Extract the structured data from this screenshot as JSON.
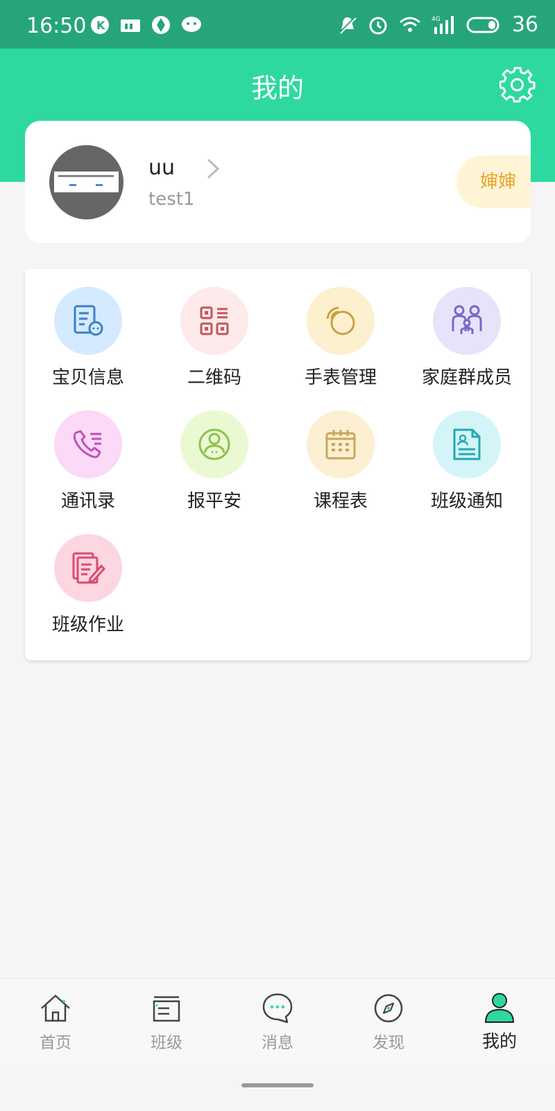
{
  "status_bar": {
    "time": "16:50",
    "left_icons": [
      "k-app-icon",
      "sim-card-icon",
      "aperture-icon",
      "wechat-icon"
    ],
    "right_icons": [
      "bell-muted-icon",
      "alarm-clock-icon",
      "wifi-icon",
      "signal-4g-icon",
      "battery-icon"
    ],
    "battery_level": "36"
  },
  "header": {
    "title": "我的",
    "settings_icon": "gear-icon"
  },
  "profile": {
    "username": "uu",
    "account": "test1",
    "role": "婶婶"
  },
  "menu": {
    "items": [
      {
        "label": "宝贝信息",
        "icon": "baby-info-icon",
        "bg": "#d4eafe",
        "color": "#3d7fc7"
      },
      {
        "label": "二维码",
        "icon": "qr-code-icon",
        "bg": "#fdeaea",
        "color": "#c1565c"
      },
      {
        "label": "手表管理",
        "icon": "watch-icon",
        "bg": "#fdf0cf",
        "color": "#caa141"
      },
      {
        "label": "家庭群成员",
        "icon": "family-icon",
        "bg": "#e7e3fb",
        "color": "#7b67c6"
      },
      {
        "label": "通讯录",
        "icon": "phone-book-icon",
        "bg": "#fbd9f7",
        "color": "#c150b7"
      },
      {
        "label": "报平安",
        "icon": "safe-report-icon",
        "bg": "#ebf9d3",
        "color": "#8bc24a"
      },
      {
        "label": "课程表",
        "icon": "calendar-icon",
        "bg": "#fcefd2",
        "color": "#c9a65a"
      },
      {
        "label": "班级通知",
        "icon": "notice-icon",
        "bg": "#d3f5f8",
        "color": "#25a7b8"
      },
      {
        "label": "班级作业",
        "icon": "homework-icon",
        "bg": "#fcd6e0",
        "color": "#d84b6f"
      }
    ]
  },
  "bottom_nav": {
    "items": [
      {
        "label": "首页",
        "icon": "home-icon",
        "active": false
      },
      {
        "label": "班级",
        "icon": "class-icon",
        "active": false
      },
      {
        "label": "消息",
        "icon": "message-icon",
        "active": false
      },
      {
        "label": "发现",
        "icon": "compass-icon",
        "active": false
      },
      {
        "label": "我的",
        "icon": "profile-icon",
        "active": true
      }
    ],
    "active_color": "#2dd9a0"
  }
}
